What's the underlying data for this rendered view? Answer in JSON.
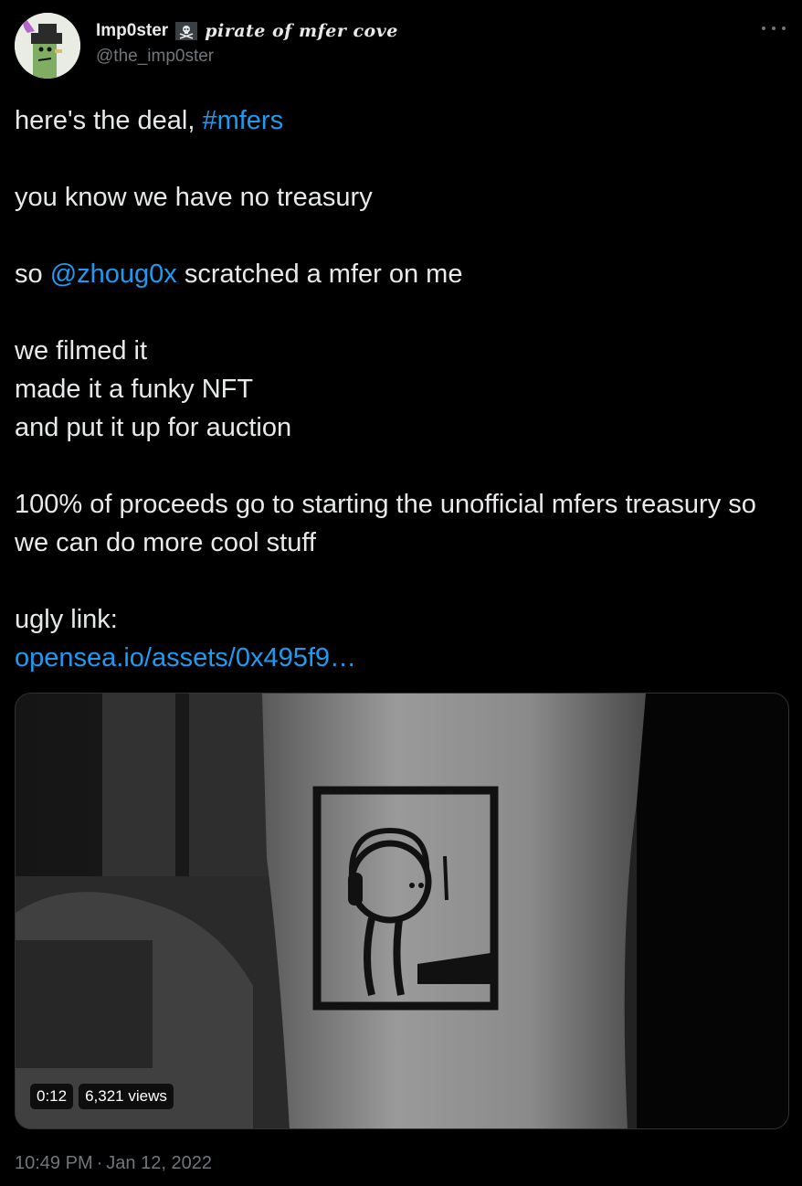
{
  "author": {
    "display_name": "Imp0ster",
    "name_suffix": "pirate of mfer cove",
    "handle": "@the_imp0ster",
    "badge_icon": "skull-crossbones-flag-icon"
  },
  "tweet": {
    "line1_prefix": "here's the deal, ",
    "hashtag": "#mfers",
    "line2": "you know we have no treasury",
    "line3_prefix": "so ",
    "mention": "@zhoug0x",
    "line3_suffix": " scratched a mfer on me",
    "line4": "we filmed it",
    "line5": "made it a funky NFT",
    "line6": "and put it up for auction",
    "line7": "100% of proceeds go to starting the unofficial mfers treasury so we can do more cool stuff",
    "line8": "ugly link:",
    "link": "opensea.io/assets/0x495f9…"
  },
  "video": {
    "duration": "0:12",
    "views": "6,321 views"
  },
  "footer": {
    "time": "10:49 PM",
    "separator": "·",
    "date": "Jan 12, 2022"
  },
  "colors": {
    "background": "#000000",
    "text": "#e7e9ea",
    "muted": "#71767b",
    "link": "#1d9bf0"
  }
}
